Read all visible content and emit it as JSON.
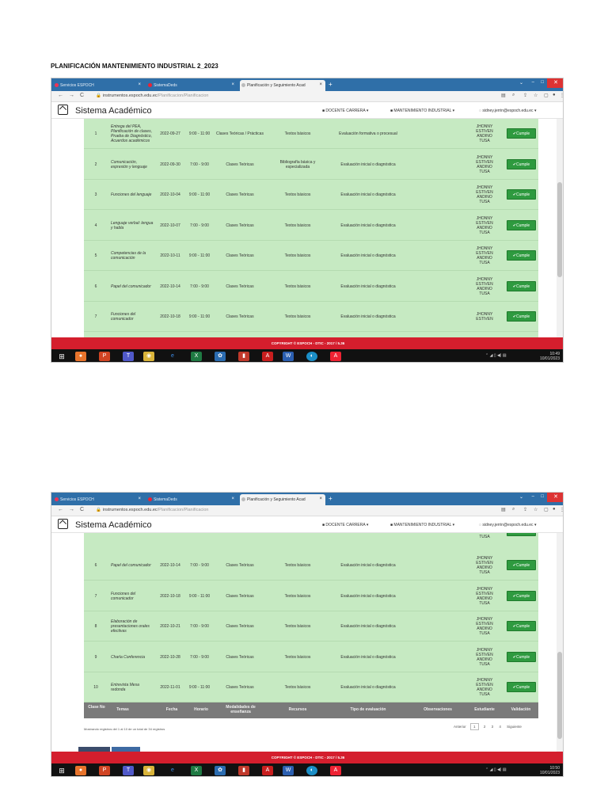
{
  "doc_title": "PLANIFICACIÓN MANTENIMIENTO INDUSTRIAL 2_2023",
  "browser": {
    "tabs": [
      "Servicios ESPOCH",
      "SistemaDeds",
      "Planificación y Seguimiento Acad"
    ],
    "url_domain": "instrumentos.espoch.edu.ec",
    "url_path": "/Planificacion/Planificacion"
  },
  "app": {
    "title": "Sistema Académico",
    "menu_role": "DOCENTE CARRERA ▾",
    "menu_career": "MANTENIMIENTO INDUSTRIAL ▾",
    "menu_user": "sidney.jerrin@espoch.edu.ec ▾"
  },
  "button_label": "Cumple",
  "copyright": "COPYRIGHT © ESPOCH - DTIC - 2017 / 5.36",
  "shot1": {
    "rows": [
      {
        "num": "1",
        "tema": "Entrega del PEA, Planificación de clases, Prueba de Diagnóstico, Acuerdos académicos",
        "fecha": "2022-09-27",
        "hora": "9:00 - 11:00",
        "mod": "Clases Teóricas / Prácticas",
        "rec": "Textos básicos",
        "tipo": "Evaluación formativa o procesual",
        "est": "JHONNY ESTIVEN ANDINO TUSA"
      },
      {
        "num": "2",
        "tema": "Comunicación, expresión y lenguaje",
        "fecha": "2022-09-30",
        "hora": "7:00 - 9:00",
        "mod": "Clases Teóricas",
        "rec": "Bibliografía básica y especializada",
        "tipo": "Evaluación inicial o diagnóstica",
        "est": "JHONNY ESTIVEN ANDINO TUSA"
      },
      {
        "num": "3",
        "tema": "Funciones del lenguaje",
        "fecha": "2022-10-04",
        "hora": "9:00 - 11:00",
        "mod": "Clases Teóricas",
        "rec": "Textos básicos",
        "tipo": "Evaluación inicial o diagnóstica",
        "est": "JHONNY ESTIVEN ANDINO TUSA"
      },
      {
        "num": "4",
        "tema": "Lenguaje verbal: lengua y habla",
        "fecha": "2022-10-07",
        "hora": "7:00 - 9:00",
        "mod": "Clases Teóricas",
        "rec": "Textos básicos",
        "tipo": "Evaluación inicial o diagnóstica",
        "est": "JHONNY ESTIVEN ANDINO TUSA"
      },
      {
        "num": "5",
        "tema": "Competencias de la comunicación",
        "fecha": "2022-10-11",
        "hora": "9:00 - 11:00",
        "mod": "Clases Teóricas",
        "rec": "Textos básicos",
        "tipo": "Evaluación inicial o diagnóstica",
        "est": "JHONNY ESTIVEN ANDINO TUSA"
      },
      {
        "num": "6",
        "tema": "Papel del comunicador",
        "fecha": "2022-10-14",
        "hora": "7:00 - 9:00",
        "mod": "Clases Teóricas",
        "rec": "Textos básicos",
        "tipo": "Evaluación inicial o diagnóstica",
        "est": "JHONNY ESTIVEN ANDINO TUSA"
      },
      {
        "num": "7",
        "tema": "Funciones del comunicador",
        "fecha": "2022-10-18",
        "hora": "9:00 - 11:00",
        "mod": "Clases Teóricas",
        "rec": "Textos básicos",
        "tipo": "Evaluación inicial o diagnóstica",
        "est": "JHONNY ESTIVEN"
      }
    ],
    "clock_time": "10:49",
    "clock_date": "10/01/2023"
  },
  "shot2": {
    "partial_top_student": "TUSA",
    "rows": [
      {
        "num": "6",
        "tema": "Papel del comunicador",
        "fecha": "2022-10-14",
        "hora": "7:00 - 9:00",
        "mod": "Clases Teóricas",
        "rec": "Textos básicos",
        "tipo": "Evaluación inicial o diagnóstica",
        "est": "JHONNY ESTIVEN ANDINO TUSA"
      },
      {
        "num": "7",
        "tema": "Funciones del comunicador",
        "fecha": "2022-10-18",
        "hora": "9:00 - 11:00",
        "mod": "Clases Teóricas",
        "rec": "Textos básicos",
        "tipo": "Evaluación inicial o diagnóstica",
        "est": "JHONNY ESTIVEN ANDINO TUSA"
      },
      {
        "num": "8",
        "tema": "Elaboración de presentaciones orales efectivas",
        "fecha": "2022-10-21",
        "hora": "7:00 - 9:00",
        "mod": "Clases Teóricas",
        "rec": "Textos básicos",
        "tipo": "Evaluación inicial o diagnóstica",
        "est": "JHONNY ESTIVEN ANDINO TUSA"
      },
      {
        "num": "9",
        "tema": "Charla Conferencia",
        "fecha": "2022-10-28",
        "hora": "7:00 - 9:00",
        "mod": "Clases Teóricas",
        "rec": "Textos básicos",
        "tipo": "Evaluación inicial o diagnóstica",
        "est": "JHONNY ESTIVEN ANDINO TUSA"
      },
      {
        "num": "10",
        "tema": "Entrevista Mesa redonda",
        "fecha": "2022-11-01",
        "hora": "9:00 - 11:00",
        "mod": "Clases Teóricas",
        "rec": "Textos básicos",
        "tipo": "Evaluación inicial o diagnóstica",
        "est": "JHONNY ESTIVEN ANDINO TUSA"
      }
    ],
    "headers": {
      "clase": "Clase No",
      "temas": "Temas",
      "fecha": "Fecha",
      "horario": "Horario",
      "modalidades": "Modalidades de enseñanza",
      "recursos": "Recursos",
      "tipo": "Tipo de evaluación",
      "obs": "Observaciones",
      "estudiante": "Estudiante",
      "validacion": "Validación"
    },
    "showing": "Mostrando registros del 1 al 10 de un total de 34 registros",
    "pager": {
      "prev": "Anterior",
      "p1": "1",
      "p2": "2",
      "p3": "3",
      "p4": "4",
      "next": "Siguiente"
    },
    "clock_time": "10:50",
    "clock_date": "10/01/2023"
  }
}
